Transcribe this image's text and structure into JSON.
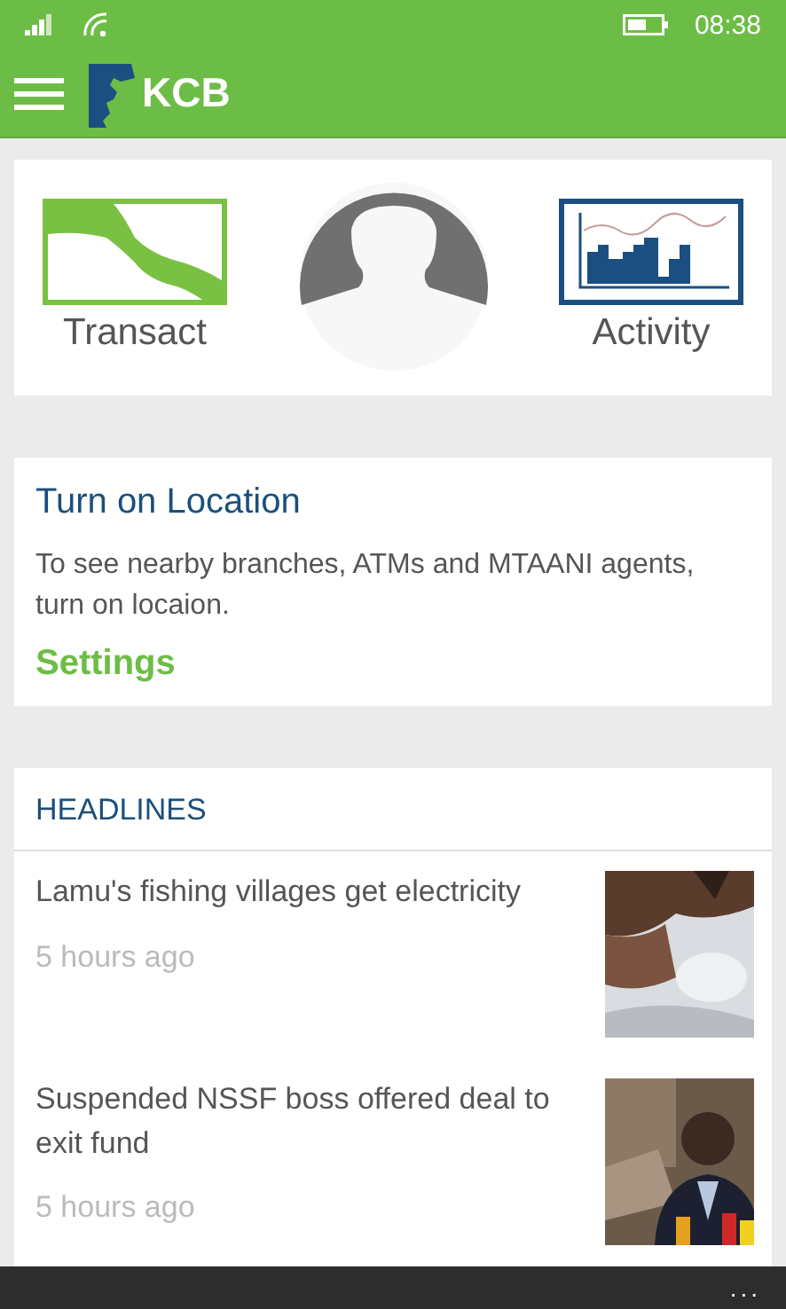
{
  "status_bar": {
    "time": "08:38"
  },
  "app_bar": {
    "logo_text": "KCB"
  },
  "shortcuts": [
    {
      "kind": "transact",
      "label": "Transact"
    },
    {
      "kind": "profile"
    },
    {
      "kind": "activity",
      "label": "Activity"
    }
  ],
  "location_card": {
    "title": "Turn on Location",
    "message": "To see nearby branches, ATMs and MTAANI agents, turn on locaion.",
    "link": "Settings"
  },
  "headlines": {
    "title": "HEADLINES",
    "items": [
      {
        "title": "Lamu's fishing villages get electricity",
        "time": "5 hours ago"
      },
      {
        "title": "Suspended NSSF boss offered deal to exit fund",
        "time": "5 hours ago"
      }
    ]
  },
  "bottom_bar": {
    "more": "..."
  }
}
